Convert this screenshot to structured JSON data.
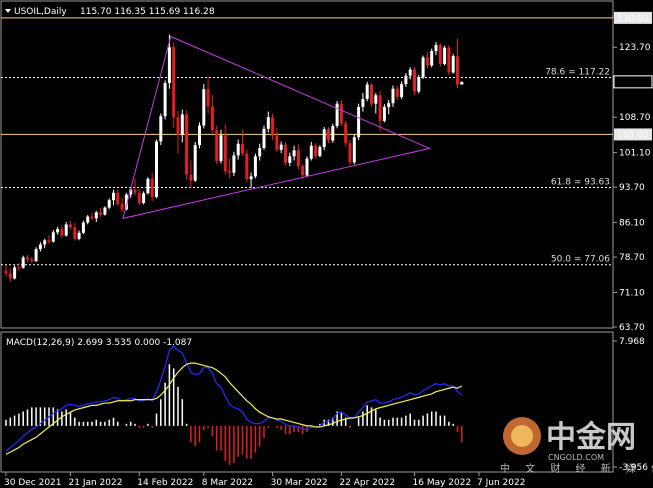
{
  "header": {
    "symbol": "USOIL,Daily",
    "ohlc": "115.70 116.35 115.69 116.28",
    "macd_label": "MACD(12,26,9) 2.699 3.535 0.000 -1.087"
  },
  "colors": {
    "background": "#000000",
    "bull": "#ffffff",
    "bear": "#e02020",
    "level_line": "#f5d27a",
    "fib_line": "#ffffff",
    "triangle": "#c040e0",
    "macd_main": "#2030ff",
    "macd_signal": "#f0f060",
    "hist_pos": "#ffffff",
    "hist_neg": "#e02020"
  },
  "price_axis": {
    "ticks": [
      "130.40",
      "123.70",
      "116.28",
      "108.70",
      "101.10",
      "93.70",
      "86.10",
      "78.70",
      "71.10",
      "63.70"
    ],
    "current_price_label": "116.28"
  },
  "macd_axis": {
    "ticks": [
      "7.968",
      "-3.956"
    ]
  },
  "levels": [
    {
      "value": 130.0,
      "label": "130.00"
    },
    {
      "value": 105.0,
      "label": "105.00"
    }
  ],
  "fib_levels": [
    {
      "value": 117.22,
      "label": "78.6 = 117.22"
    },
    {
      "value": 93.63,
      "label": "61.8 = 93.63"
    },
    {
      "value": 77.06,
      "label": "50.0 = 77.06"
    }
  ],
  "date_axis": [
    "30 Dec 2021",
    "21 Jan 2022",
    "14 Feb 2022",
    "8 Mar 2022",
    "30 Mar 2022",
    "22 Apr 2022",
    "16 May 2022",
    "7 Jun 2022"
  ],
  "watermark": {
    "logo_text": "中金网",
    "url": "CNGOLD.COM",
    "slogan": "中 文 财 经 新 媒 体"
  },
  "chart_data": {
    "type": "candlestick",
    "title": "USOIL,Daily",
    "ylim": [
      63.7,
      130.4
    ],
    "candles": [
      [
        75.8,
        76.9,
        74.5,
        75.2
      ],
      [
        75.2,
        76.3,
        73.3,
        74.1
      ],
      [
        74.1,
        76.9,
        73.9,
        76.5
      ],
      [
        76.5,
        77.4,
        75.8,
        76.4
      ],
      [
        76.4,
        79.0,
        76.2,
        78.6
      ],
      [
        78.6,
        79.1,
        77.6,
        78.2
      ],
      [
        78.2,
        78.7,
        77.4,
        77.8
      ],
      [
        77.8,
        80.8,
        77.7,
        80.4
      ],
      [
        80.4,
        81.9,
        79.9,
        81.4
      ],
      [
        81.4,
        82.6,
        80.6,
        82.3
      ],
      [
        82.3,
        83.4,
        81.5,
        82.0
      ],
      [
        82.0,
        84.5,
        81.8,
        84.0
      ],
      [
        84.0,
        85.2,
        83.5,
        84.7
      ],
      [
        84.7,
        85.5,
        82.8,
        83.3
      ],
      [
        83.3,
        86.2,
        83.1,
        85.7
      ],
      [
        85.7,
        86.4,
        84.6,
        85.1
      ],
      [
        85.1,
        86.0,
        82.2,
        82.6
      ],
      [
        82.6,
        84.4,
        82.3,
        83.9
      ],
      [
        83.9,
        86.5,
        83.6,
        86.1
      ],
      [
        86.1,
        87.7,
        85.7,
        87.4
      ],
      [
        87.4,
        88.2,
        86.6,
        87.0
      ],
      [
        87.0,
        88.6,
        86.2,
        88.3
      ],
      [
        88.3,
        89.2,
        87.3,
        87.8
      ],
      [
        87.8,
        89.6,
        87.6,
        89.3
      ],
      [
        89.3,
        91.3,
        89.0,
        90.9
      ],
      [
        90.9,
        93.1,
        89.8,
        92.5
      ],
      [
        92.5,
        93.2,
        89.6,
        90.1
      ],
      [
        90.1,
        91.4,
        88.3,
        88.9
      ],
      [
        88.9,
        92.5,
        88.7,
        92.1
      ],
      [
        92.1,
        93.6,
        91.4,
        93.2
      ],
      [
        93.2,
        95.5,
        91.9,
        92.5
      ],
      [
        92.5,
        93.3,
        89.8,
        90.3
      ],
      [
        90.3,
        92.8,
        90.0,
        92.4
      ],
      [
        92.4,
        95.8,
        92.1,
        95.5
      ],
      [
        95.5,
        96.8,
        90.6,
        91.6
      ],
      [
        91.6,
        103.9,
        91.3,
        103.5
      ],
      [
        103.5,
        109.5,
        102.7,
        108.9
      ],
      [
        108.9,
        116.6,
        108.2,
        116.0
      ],
      [
        116.0,
        126.4,
        114.8,
        123.7
      ],
      [
        123.7,
        124.7,
        106.4,
        108.7
      ],
      [
        108.7,
        110.0,
        100.9,
        104.9
      ],
      [
        104.9,
        110.3,
        103.3,
        109.3
      ],
      [
        109.3,
        110.2,
        95.2,
        96.4
      ],
      [
        96.4,
        99.4,
        93.4,
        95.1
      ],
      [
        95.1,
        103.4,
        94.8,
        102.7
      ],
      [
        102.7,
        107.6,
        102.0,
        106.9
      ],
      [
        106.9,
        115.8,
        106.3,
        114.7
      ],
      [
        114.7,
        117.4,
        109.4,
        111.0
      ],
      [
        111.0,
        113.5,
        105.2,
        105.9
      ],
      [
        105.9,
        106.9,
        98.6,
        99.3
      ],
      [
        99.3,
        106.0,
        98.8,
        104.8
      ],
      [
        104.8,
        107.2,
        96.4,
        97.1
      ],
      [
        97.1,
        99.9,
        95.5,
        96.8
      ],
      [
        96.8,
        101.3,
        96.1,
        100.5
      ],
      [
        100.5,
        103.9,
        99.6,
        103.0
      ],
      [
        103.0,
        106.0,
        100.4,
        100.9
      ],
      [
        100.9,
        101.8,
        94.8,
        95.4
      ],
      [
        95.4,
        96.8,
        93.6,
        96.0
      ],
      [
        96.0,
        100.9,
        95.6,
        100.3
      ],
      [
        100.3,
        103.0,
        99.4,
        102.1
      ],
      [
        102.1,
        106.9,
        101.7,
        106.2
      ],
      [
        106.2,
        109.9,
        105.4,
        108.7
      ],
      [
        108.7,
        109.5,
        103.8,
        104.7
      ],
      [
        104.7,
        106.3,
        101.2,
        101.7
      ],
      [
        101.7,
        103.5,
        101.0,
        102.8
      ],
      [
        102.8,
        103.4,
        98.3,
        98.9
      ],
      [
        98.9,
        101.1,
        98.2,
        100.3
      ],
      [
        100.3,
        102.6,
        99.4,
        101.6
      ],
      [
        101.6,
        102.9,
        97.5,
        98.2
      ],
      [
        98.2,
        98.6,
        95.4,
        96.2
      ],
      [
        96.2,
        100.3,
        95.9,
        99.8
      ],
      [
        99.8,
        103.4,
        99.4,
        102.6
      ],
      [
        102.6,
        103.1,
        99.8,
        100.4
      ],
      [
        100.4,
        102.7,
        100.1,
        102.3
      ],
      [
        102.3,
        106.6,
        101.6,
        106.1
      ],
      [
        106.1,
        106.6,
        103.1,
        103.7
      ],
      [
        103.7,
        107.3,
        103.2,
        106.8
      ],
      [
        106.8,
        112.2,
        106.3,
        111.6
      ],
      [
        111.6,
        112.4,
        106.8,
        107.3
      ],
      [
        107.3,
        107.9,
        102.3,
        103.1
      ],
      [
        103.1,
        103.8,
        98.4,
        99.0
      ],
      [
        99.0,
        105.1,
        98.6,
        104.4
      ],
      [
        104.4,
        111.6,
        103.8,
        110.9
      ],
      [
        110.9,
        113.9,
        109.9,
        112.6
      ],
      [
        112.6,
        116.3,
        112.1,
        115.7
      ],
      [
        115.7,
        115.9,
        110.9,
        111.6
      ],
      [
        111.6,
        113.9,
        109.5,
        113.4
      ],
      [
        113.4,
        114.4,
        105.6,
        107.9
      ],
      [
        107.9,
        111.5,
        107.6,
        110.9
      ],
      [
        110.9,
        112.4,
        109.3,
        111.7
      ],
      [
        111.7,
        115.5,
        110.9,
        114.8
      ],
      [
        114.8,
        115.4,
        112.4,
        113.0
      ],
      [
        113.0,
        116.4,
        112.6,
        115.8
      ],
      [
        115.8,
        118.2,
        115.2,
        117.6
      ],
      [
        117.6,
        119.4,
        116.8,
        118.9
      ],
      [
        118.9,
        119.5,
        113.4,
        114.2
      ],
      [
        114.2,
        117.8,
        113.8,
        117.3
      ],
      [
        117.3,
        121.9,
        116.9,
        121.5
      ],
      [
        121.5,
        122.7,
        119.2,
        119.8
      ],
      [
        119.8,
        123.4,
        119.4,
        122.9
      ],
      [
        122.9,
        124.8,
        122.0,
        124.2
      ],
      [
        124.2,
        124.5,
        119.5,
        120.1
      ],
      [
        120.1,
        124.0,
        119.8,
        123.6
      ],
      [
        123.6,
        124.2,
        117.7,
        118.3
      ],
      [
        118.3,
        122.3,
        118.0,
        121.8
      ],
      [
        121.8,
        125.5,
        114.9,
        115.7
      ],
      [
        115.7,
        116.35,
        115.69,
        116.28
      ]
    ],
    "triangle": [
      [
        38.3,
        126.0
      ],
      [
        98.5,
        102.0
      ],
      [
        27.2,
        87.0
      ]
    ],
    "macd": {
      "ylim": [
        -3.956,
        7.968
      ],
      "main": [
        -2.2,
        -1.9,
        -1.6,
        -1.3,
        -0.9,
        -0.6,
        -0.3,
        -0.1,
        0.2,
        0.5,
        0.8,
        1.1,
        1.3,
        1.5,
        1.8,
        1.9,
        1.8,
        1.7,
        1.8,
        1.9,
        2.0,
        2.1,
        2.1,
        2.2,
        2.3,
        2.5,
        2.4,
        2.2,
        2.3,
        2.4,
        2.4,
        2.2,
        2.2,
        2.4,
        2.2,
        3.0,
        4.0,
        5.2,
        6.6,
        7.0,
        6.6,
        6.4,
        5.5,
        4.7,
        4.5,
        4.6,
        5.1,
        5.1,
        4.6,
        3.7,
        3.4,
        2.6,
        1.9,
        1.6,
        1.5,
        1.2,
        0.6,
        0.3,
        0.2,
        0.2,
        0.4,
        0.7,
        0.7,
        0.5,
        0.4,
        0.1,
        0.0,
        0.0,
        -0.1,
        -0.3,
        -0.3,
        -0.1,
        -0.1,
        0.0,
        0.3,
        0.4,
        0.6,
        1.1,
        1.2,
        1.0,
        0.6,
        0.7,
        1.2,
        1.6,
        2.1,
        2.2,
        2.3,
        2.0,
        2.0,
        2.1,
        2.3,
        2.4,
        2.5,
        2.7,
        2.9,
        2.7,
        2.8,
        3.1,
        3.3,
        3.5,
        3.7,
        3.6,
        3.7,
        3.5,
        3.5,
        3.0,
        2.7
      ],
      "signal": [
        -2.5,
        -2.3,
        -2.1,
        -1.9,
        -1.6,
        -1.4,
        -1.2,
        -1.0,
        -0.7,
        -0.4,
        -0.1,
        0.2,
        0.5,
        0.8,
        1.0,
        1.2,
        1.4,
        1.5,
        1.6,
        1.7,
        1.8,
        1.8,
        1.9,
        2.0,
        2.0,
        2.1,
        2.2,
        2.2,
        2.2,
        2.2,
        2.3,
        2.3,
        2.3,
        2.3,
        2.3,
        2.4,
        2.7,
        3.1,
        3.6,
        4.2,
        4.7,
        5.1,
        5.4,
        5.5,
        5.5,
        5.4,
        5.3,
        5.2,
        5.1,
        4.9,
        4.6,
        4.3,
        3.8,
        3.4,
        3.0,
        2.6,
        2.2,
        1.9,
        1.5,
        1.2,
        1.0,
        0.8,
        0.7,
        0.6,
        0.6,
        0.5,
        0.4,
        0.3,
        0.2,
        0.1,
        0.0,
        0.0,
        -0.1,
        -0.1,
        0.0,
        0.1,
        0.2,
        0.4,
        0.5,
        0.6,
        0.7,
        0.7,
        0.8,
        0.9,
        1.1,
        1.3,
        1.5,
        1.6,
        1.7,
        1.8,
        1.9,
        2.0,
        2.1,
        2.2,
        2.3,
        2.4,
        2.5,
        2.6,
        2.7,
        2.8,
        3.0,
        3.1,
        3.2,
        3.3,
        3.4,
        3.3,
        3.5
      ]
    }
  }
}
